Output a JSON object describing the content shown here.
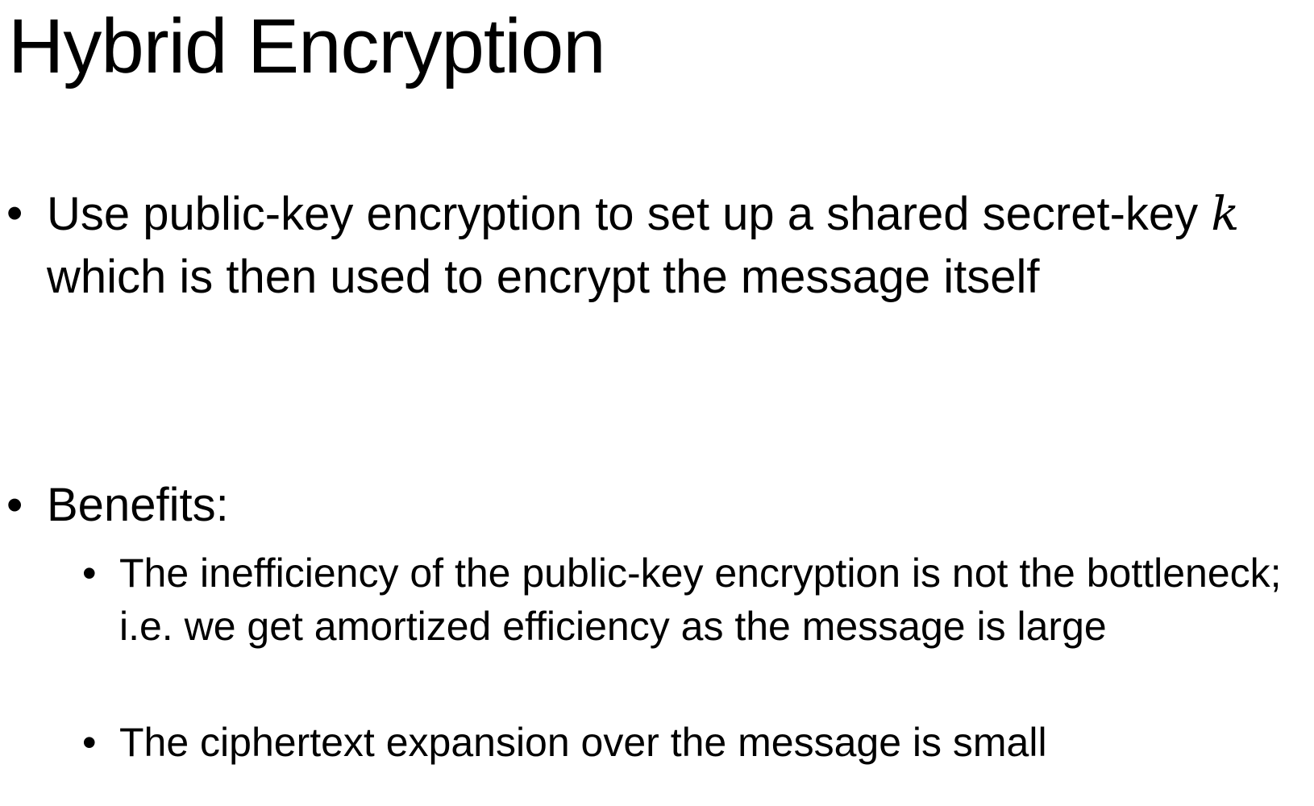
{
  "slide": {
    "title": "Hybrid Encryption",
    "bullets": [
      {
        "marker": "•",
        "text_before": "Use public-key encryption to set up a shared secret-key ",
        "math": "k",
        "text_after": " which is then used to encrypt the message itself"
      },
      {
        "marker": "•",
        "text": "Benefits:",
        "sub_bullets": [
          {
            "marker": "•",
            "text": "The inefficiency of the public-key encryption is not the bottleneck; i.e. we get amortized efficiency as the message is large"
          },
          {
            "marker": "•",
            "text": "The ciphertext expansion over the message is small"
          }
        ]
      }
    ]
  }
}
